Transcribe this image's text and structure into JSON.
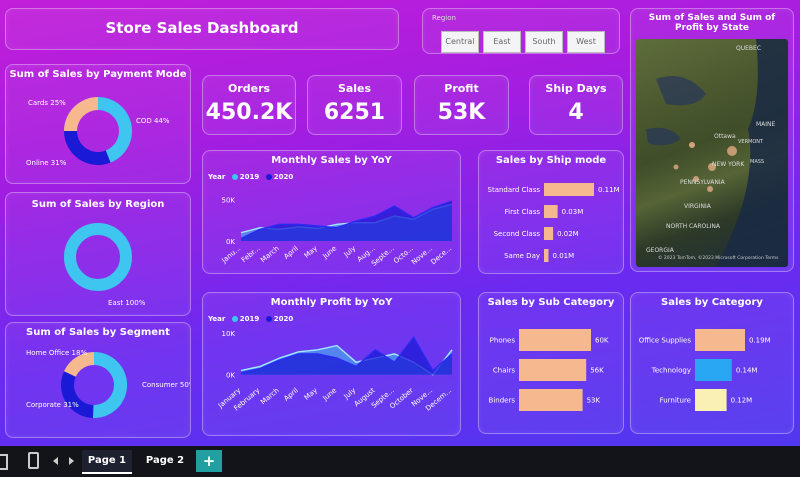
{
  "title": "Store Sales Dashboard",
  "region_slicer": {
    "label": "Region",
    "options": [
      "Central",
      "East",
      "South",
      "West"
    ]
  },
  "kpis": [
    {
      "label": "Orders",
      "value": "450.2K"
    },
    {
      "label": "Sales",
      "value": "6251"
    },
    {
      "label": "Profit",
      "value": "53K"
    },
    {
      "label": "Ship Days",
      "value": "4"
    }
  ],
  "map": {
    "title": "Sum of Sales and Sum of Profit by State",
    "place_labels": [
      "QUEBEC",
      "MAINE",
      "Ottawa",
      "VERMONT",
      "NEW YORK",
      "PENNSYLVANIA",
      "VIRGINIA",
      "NORTH CAROLINA",
      "GEORGIA",
      "MASS"
    ],
    "attribution": "© 2023 TomTom, ©2023 Microsoft Corporation Terms"
  },
  "colors": {
    "accent_blue": "#1a1ad6",
    "light_blue": "#3ec5f0",
    "peach": "#f6b88f",
    "cyan_bar": "#2aa7f3",
    "cream": "#faf0b4"
  },
  "tabs": {
    "page1": "Page 1",
    "page2": "Page 2",
    "add": "+"
  },
  "chart_data": [
    {
      "id": "payment_mode",
      "type": "pie",
      "title": "Sum of Sales by Payment Mode",
      "categories": [
        "COD",
        "Online",
        "Cards"
      ],
      "values": [
        44,
        31,
        25
      ],
      "labels": [
        "COD 44%",
        "Online 31%",
        "Cards 25%"
      ],
      "colors": [
        "#3ec5f0",
        "#1a1ad6",
        "#f6b88f"
      ]
    },
    {
      "id": "region",
      "type": "pie",
      "title": "Sum of Sales by Region",
      "categories": [
        "East"
      ],
      "values": [
        100
      ],
      "labels": [
        "East 100%"
      ],
      "colors": [
        "#3ec5f0"
      ]
    },
    {
      "id": "segment",
      "type": "pie",
      "title": "Sum of Sales by Segment",
      "categories": [
        "Consumer",
        "Corporate",
        "Home Office"
      ],
      "values": [
        50,
        31,
        18
      ],
      "labels": [
        "Consumer 50%",
        "Corporate 31%",
        "Home Office 18%"
      ],
      "colors": [
        "#3ec5f0",
        "#1a1ad6",
        "#f6b88f"
      ]
    },
    {
      "id": "monthly_sales",
      "type": "area",
      "title": "Monthly Sales by YoY",
      "legend_title": "Year",
      "categories": [
        "January",
        "February",
        "March",
        "April",
        "May",
        "June",
        "July",
        "August",
        "September",
        "October",
        "November",
        "December"
      ],
      "tick_labels": [
        "Janu...",
        "Febr...",
        "March",
        "April",
        "May",
        "June",
        "July",
        "Aug...",
        "Septe...",
        "Octo...",
        "Nove...",
        "Dece..."
      ],
      "yticks": [
        "0K",
        "50K"
      ],
      "ylim": [
        0,
        60
      ],
      "series": [
        {
          "name": "2019",
          "values": [
            10,
            16,
            14,
            17,
            15,
            20,
            22,
            22,
            30,
            26,
            38,
            44
          ],
          "color": "#3ec5f0"
        },
        {
          "name": "2020",
          "values": [
            3,
            14,
            20,
            20,
            18,
            16,
            24,
            30,
            42,
            28,
            40,
            48
          ],
          "color": "#1a1ad6"
        }
      ]
    },
    {
      "id": "monthly_profit",
      "type": "area",
      "title": "Monthly Profit by YoY",
      "legend_title": "Year",
      "categories": [
        "January",
        "February",
        "March",
        "April",
        "May",
        "June",
        "July",
        "August",
        "September",
        "October",
        "November",
        "December"
      ],
      "tick_labels": [
        "January",
        "February",
        "March",
        "April",
        "May",
        "June",
        "July",
        "August",
        "Septe...",
        "October",
        "Nove...",
        "Decem..."
      ],
      "yticks": [
        "0K",
        "10K"
      ],
      "ylim": [
        -2,
        11
      ],
      "series": [
        {
          "name": "2019",
          "values": [
            1,
            2,
            4,
            5.5,
            6,
            7,
            3,
            4,
            5,
            3,
            0,
            6
          ],
          "color": "#3ec5f0"
        },
        {
          "name": "2020",
          "values": [
            0.5,
            1.5,
            3.5,
            5,
            5,
            4,
            2,
            6,
            3,
            9,
            1,
            5
          ],
          "color": "#1a1ad6"
        }
      ]
    },
    {
      "id": "ship_mode",
      "type": "bar",
      "title": "Sales by Ship mode",
      "categories": [
        "Standard Class",
        "First Class",
        "Second Class",
        "Same Day"
      ],
      "values": [
        0.11,
        0.03,
        0.02,
        0.01
      ],
      "value_labels": [
        "0.11M",
        "0.03M",
        "0.02M",
        "0.01M"
      ],
      "color": "#f6b88f"
    },
    {
      "id": "sub_category",
      "type": "bar",
      "title": "Sales by Sub Category",
      "categories": [
        "Phones",
        "Chairs",
        "Binders"
      ],
      "values": [
        60,
        56,
        53
      ],
      "value_labels": [
        "60K",
        "56K",
        "53K"
      ],
      "color": "#f6b88f"
    },
    {
      "id": "category",
      "type": "bar",
      "title": "Sales by Category",
      "categories": [
        "Office Supplies",
        "Technology",
        "Furniture"
      ],
      "values": [
        0.19,
        0.14,
        0.12
      ],
      "value_labels": [
        "0.19M",
        "0.14M",
        "0.12M"
      ],
      "colors": [
        "#f6b88f",
        "#2aa7f3",
        "#faf0b4"
      ]
    }
  ]
}
